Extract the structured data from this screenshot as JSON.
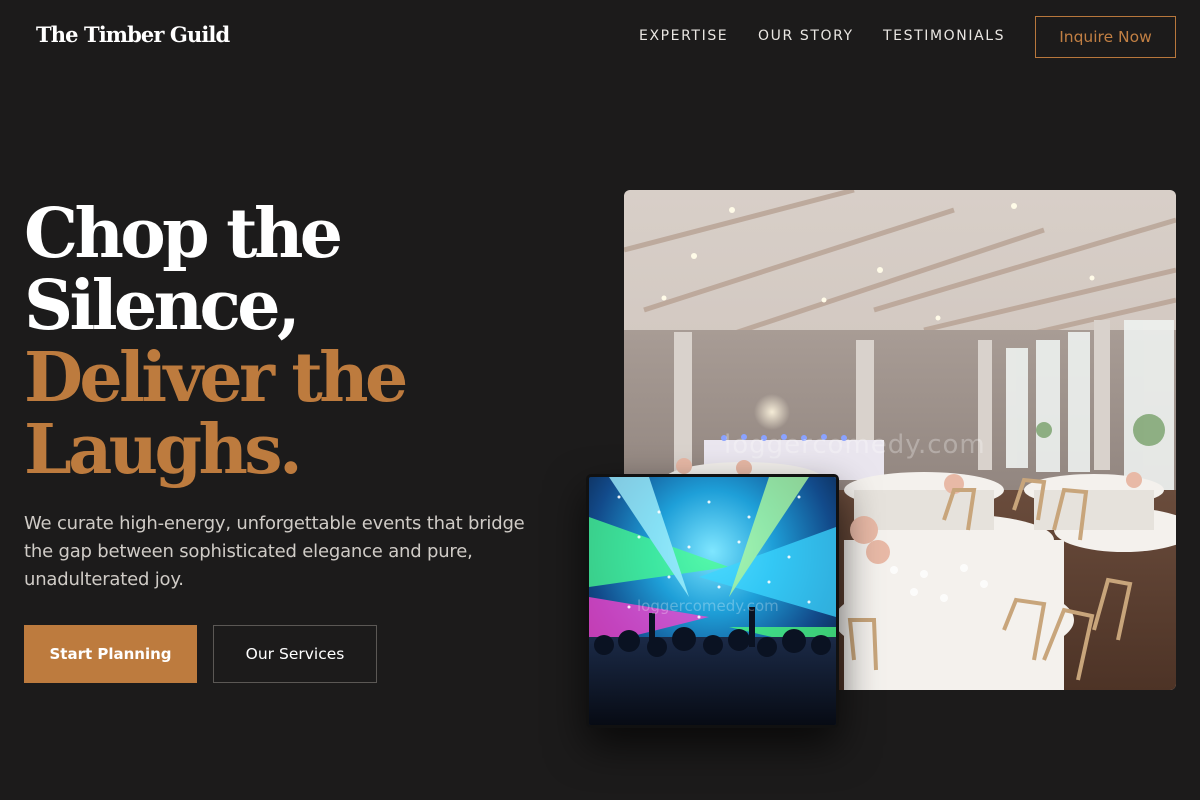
{
  "header": {
    "logo": "The Timber Guild",
    "nav": [
      {
        "label": "EXPERTISE"
      },
      {
        "label": "OUR STORY"
      },
      {
        "label": "TESTIMONIALS"
      }
    ],
    "cta_label": "Inquire Now"
  },
  "hero": {
    "headline": {
      "line1": "Chop the",
      "line2": "Silence,",
      "line3": "Deliver the",
      "line4": "Laughs."
    },
    "description": "We curate high-energy, unforgettable events that bridge the gap between sophisticated elegance and pure, unadulterated joy.",
    "primary_button": "Start Planning",
    "secondary_button": "Our Services",
    "images": {
      "main_watermark": "loggercomedy.com",
      "inset_watermark": "loggercomedy.com"
    }
  },
  "colors": {
    "background": "#1c1b1b",
    "accent": "#bd7b3e",
    "text": "#ffffff",
    "muted_text": "#cfcbc6"
  }
}
